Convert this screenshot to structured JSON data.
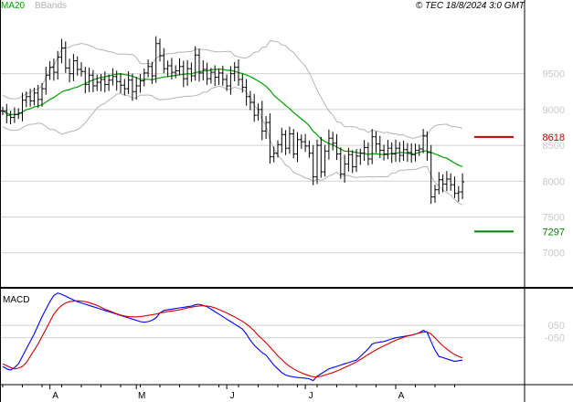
{
  "chart_data": [
    {
      "type": "candlestick",
      "instrument_note": "",
      "legend": [
        {
          "label": "MA20",
          "color": "#00a000"
        },
        {
          "label": "BBands",
          "color": "#b4b4b4"
        }
      ],
      "copyright": "© TEC 18/8/2024 3:0 GMT",
      "y_ticks": [
        9500,
        9000,
        8500,
        8000,
        7500,
        7000
      ],
      "y_tick_labels": [
        "9500",
        "9000",
        "8500",
        "8000",
        "7500",
        "7000"
      ],
      "ylim": [
        6550,
        10350
      ],
      "x_labels": [
        "A",
        "M",
        "J",
        "J",
        "A"
      ],
      "x_label_dates": [
        "2024-04-01",
        "2024-05-01",
        "2024-06-03",
        "2024-07-01",
        "2024-08-01"
      ],
      "levels": [
        {
          "value": 8618,
          "label": "8618",
          "color": "#c00000"
        },
        {
          "value": 7297,
          "label": "7297",
          "color": "#008000"
        }
      ],
      "colors": {
        "candle": "#000000",
        "ma": "#00a000",
        "bbands": "#b4b4b4",
        "grid": "#d0d0d0",
        "axis": "#000000"
      },
      "closes": [
        8980,
        8920,
        8890,
        8930,
        8950,
        9130,
        9180,
        9120,
        9230,
        9140,
        9290,
        9480,
        9590,
        9520,
        9730,
        9860,
        9580,
        9500,
        9680,
        9560,
        9530,
        9350,
        9480,
        9330,
        9380,
        9420,
        9350,
        9410,
        9460,
        9390,
        9340,
        9290,
        9410,
        9250,
        9330,
        9400,
        9510,
        9600,
        9470,
        9920,
        9750,
        9570,
        9610,
        9520,
        9540,
        9600,
        9430,
        9570,
        9470,
        9760,
        9510,
        9560,
        9430,
        9520,
        9450,
        9510,
        9420,
        9330,
        9500,
        9590,
        9420,
        9310,
        9180,
        9100,
        8920,
        9000,
        8700,
        8820,
        8340,
        8390,
        8510,
        8650,
        8460,
        8660,
        8380,
        8580,
        8550,
        8490,
        8390,
        8060,
        8500,
        8130,
        8420,
        8600,
        8530,
        8380,
        8100,
        8240,
        8370,
        8200,
        8350,
        8390,
        8470,
        8310,
        8620,
        8520,
        8430,
        8380,
        8460,
        8380,
        8460,
        8360,
        8440,
        8400,
        8370,
        8430,
        8450,
        8630,
        8400,
        7780,
        7880,
        8020,
        7960,
        8030,
        7950,
        7830,
        7850,
        7990
      ]
    },
    {
      "type": "line",
      "title": "MACD",
      "series": [
        {
          "name": "",
          "color": "#0000ff",
          "values": [
            -280,
            -300,
            -310,
            -290,
            -260,
            -200,
            -140,
            -80,
            -20,
            50,
            120,
            180,
            240,
            290,
            310,
            300,
            285,
            270,
            255,
            240,
            230,
            220,
            210,
            200,
            190,
            180,
            170,
            160,
            150,
            140,
            130,
            120,
            110,
            100,
            90,
            80,
            75,
            80,
            90,
            110,
            150,
            170,
            175,
            180,
            185,
            190,
            195,
            200,
            205,
            215,
            220,
            210,
            200,
            180,
            160,
            140,
            120,
            100,
            80,
            60,
            40,
            20,
            -20,
            -70,
            -110,
            -140,
            -170,
            -190,
            -230,
            -270,
            -300,
            -330,
            -350,
            -360,
            -365,
            -370,
            -372,
            -375,
            -380,
            -395,
            -360,
            -340,
            -320,
            -300,
            -290,
            -280,
            -270,
            -260,
            -250,
            -240,
            -230,
            -200,
            -170,
            -140,
            -100,
            -90,
            -85,
            -80,
            -70,
            -60,
            -50,
            -45,
            -40,
            -35,
            -30,
            -20,
            -10,
            10,
            -5,
            -80,
            -150,
            -200,
            -210,
            -220,
            -230,
            -240,
            -235,
            -230
          ]
        },
        {
          "name": "",
          "color": "#d00000",
          "values": [
            -260,
            -275,
            -290,
            -300,
            -295,
            -280,
            -250,
            -200,
            -150,
            -100,
            -40,
            20,
            80,
            140,
            180,
            210,
            230,
            240,
            245,
            248,
            245,
            240,
            232,
            222,
            210,
            195,
            180,
            168,
            155,
            143,
            133,
            125,
            120,
            118,
            118,
            120,
            125,
            130,
            135,
            140,
            150,
            155,
            160,
            165,
            170,
            175,
            182,
            190,
            196,
            202,
            206,
            208,
            205,
            200,
            190,
            178,
            164,
            150,
            134,
            118,
            100,
            82,
            60,
            35,
            5,
            -30,
            -60,
            -90,
            -125,
            -160,
            -195,
            -225,
            -255,
            -280,
            -300,
            -318,
            -332,
            -345,
            -355,
            -365,
            -365,
            -360,
            -350,
            -340,
            -330,
            -318,
            -305,
            -290,
            -275,
            -260,
            -245,
            -225,
            -205,
            -185,
            -165,
            -148,
            -130,
            -115,
            -100,
            -85,
            -70,
            -58,
            -46,
            -36,
            -28,
            -20,
            -12,
            -5,
            -3,
            -20,
            -50,
            -85,
            -115,
            -140,
            -165,
            -185,
            -200,
            -212
          ]
        }
      ],
      "y_ticks": [
        50,
        -50
      ],
      "y_tick_labels": [
        "050",
        "-050"
      ],
      "ylim": [
        -420,
        330
      ]
    }
  ]
}
